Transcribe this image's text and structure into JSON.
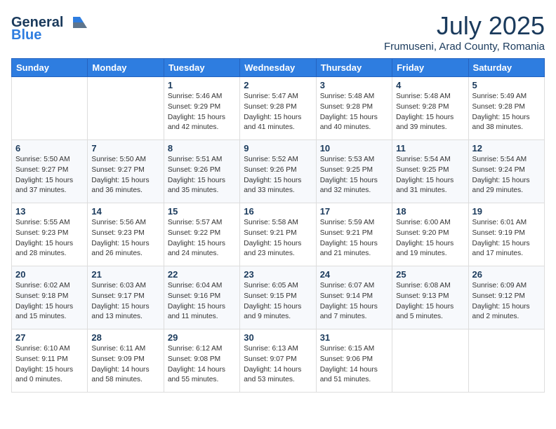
{
  "header": {
    "logo_general": "General",
    "logo_blue": "Blue",
    "month_title": "July 2025",
    "subtitle": "Frumuseni, Arad County, Romania"
  },
  "weekdays": [
    "Sunday",
    "Monday",
    "Tuesday",
    "Wednesday",
    "Thursday",
    "Friday",
    "Saturday"
  ],
  "weeks": [
    [
      {
        "day": "",
        "info": ""
      },
      {
        "day": "",
        "info": ""
      },
      {
        "day": "1",
        "info": "Sunrise: 5:46 AM\nSunset: 9:29 PM\nDaylight: 15 hours\nand 42 minutes."
      },
      {
        "day": "2",
        "info": "Sunrise: 5:47 AM\nSunset: 9:28 PM\nDaylight: 15 hours\nand 41 minutes."
      },
      {
        "day": "3",
        "info": "Sunrise: 5:48 AM\nSunset: 9:28 PM\nDaylight: 15 hours\nand 40 minutes."
      },
      {
        "day": "4",
        "info": "Sunrise: 5:48 AM\nSunset: 9:28 PM\nDaylight: 15 hours\nand 39 minutes."
      },
      {
        "day": "5",
        "info": "Sunrise: 5:49 AM\nSunset: 9:28 PM\nDaylight: 15 hours\nand 38 minutes."
      }
    ],
    [
      {
        "day": "6",
        "info": "Sunrise: 5:50 AM\nSunset: 9:27 PM\nDaylight: 15 hours\nand 37 minutes."
      },
      {
        "day": "7",
        "info": "Sunrise: 5:50 AM\nSunset: 9:27 PM\nDaylight: 15 hours\nand 36 minutes."
      },
      {
        "day": "8",
        "info": "Sunrise: 5:51 AM\nSunset: 9:26 PM\nDaylight: 15 hours\nand 35 minutes."
      },
      {
        "day": "9",
        "info": "Sunrise: 5:52 AM\nSunset: 9:26 PM\nDaylight: 15 hours\nand 33 minutes."
      },
      {
        "day": "10",
        "info": "Sunrise: 5:53 AM\nSunset: 9:25 PM\nDaylight: 15 hours\nand 32 minutes."
      },
      {
        "day": "11",
        "info": "Sunrise: 5:54 AM\nSunset: 9:25 PM\nDaylight: 15 hours\nand 31 minutes."
      },
      {
        "day": "12",
        "info": "Sunrise: 5:54 AM\nSunset: 9:24 PM\nDaylight: 15 hours\nand 29 minutes."
      }
    ],
    [
      {
        "day": "13",
        "info": "Sunrise: 5:55 AM\nSunset: 9:23 PM\nDaylight: 15 hours\nand 28 minutes."
      },
      {
        "day": "14",
        "info": "Sunrise: 5:56 AM\nSunset: 9:23 PM\nDaylight: 15 hours\nand 26 minutes."
      },
      {
        "day": "15",
        "info": "Sunrise: 5:57 AM\nSunset: 9:22 PM\nDaylight: 15 hours\nand 24 minutes."
      },
      {
        "day": "16",
        "info": "Sunrise: 5:58 AM\nSunset: 9:21 PM\nDaylight: 15 hours\nand 23 minutes."
      },
      {
        "day": "17",
        "info": "Sunrise: 5:59 AM\nSunset: 9:21 PM\nDaylight: 15 hours\nand 21 minutes."
      },
      {
        "day": "18",
        "info": "Sunrise: 6:00 AM\nSunset: 9:20 PM\nDaylight: 15 hours\nand 19 minutes."
      },
      {
        "day": "19",
        "info": "Sunrise: 6:01 AM\nSunset: 9:19 PM\nDaylight: 15 hours\nand 17 minutes."
      }
    ],
    [
      {
        "day": "20",
        "info": "Sunrise: 6:02 AM\nSunset: 9:18 PM\nDaylight: 15 hours\nand 15 minutes."
      },
      {
        "day": "21",
        "info": "Sunrise: 6:03 AM\nSunset: 9:17 PM\nDaylight: 15 hours\nand 13 minutes."
      },
      {
        "day": "22",
        "info": "Sunrise: 6:04 AM\nSunset: 9:16 PM\nDaylight: 15 hours\nand 11 minutes."
      },
      {
        "day": "23",
        "info": "Sunrise: 6:05 AM\nSunset: 9:15 PM\nDaylight: 15 hours\nand 9 minutes."
      },
      {
        "day": "24",
        "info": "Sunrise: 6:07 AM\nSunset: 9:14 PM\nDaylight: 15 hours\nand 7 minutes."
      },
      {
        "day": "25",
        "info": "Sunrise: 6:08 AM\nSunset: 9:13 PM\nDaylight: 15 hours\nand 5 minutes."
      },
      {
        "day": "26",
        "info": "Sunrise: 6:09 AM\nSunset: 9:12 PM\nDaylight: 15 hours\nand 2 minutes."
      }
    ],
    [
      {
        "day": "27",
        "info": "Sunrise: 6:10 AM\nSunset: 9:11 PM\nDaylight: 15 hours\nand 0 minutes."
      },
      {
        "day": "28",
        "info": "Sunrise: 6:11 AM\nSunset: 9:09 PM\nDaylight: 14 hours\nand 58 minutes."
      },
      {
        "day": "29",
        "info": "Sunrise: 6:12 AM\nSunset: 9:08 PM\nDaylight: 14 hours\nand 55 minutes."
      },
      {
        "day": "30",
        "info": "Sunrise: 6:13 AM\nSunset: 9:07 PM\nDaylight: 14 hours\nand 53 minutes."
      },
      {
        "day": "31",
        "info": "Sunrise: 6:15 AM\nSunset: 9:06 PM\nDaylight: 14 hours\nand 51 minutes."
      },
      {
        "day": "",
        "info": ""
      },
      {
        "day": "",
        "info": ""
      }
    ]
  ]
}
